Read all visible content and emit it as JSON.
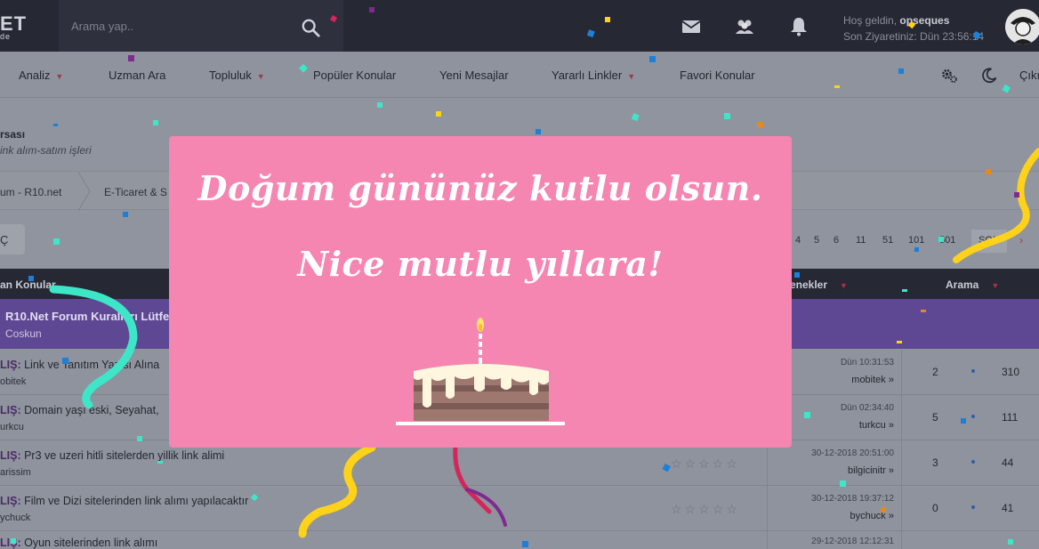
{
  "header": {
    "logo_text": "ET",
    "logo_sub": "de",
    "search_placeholder": "Arama yap..",
    "welcome_prefix": "Hoş geldin,",
    "username": "opseques",
    "last_visit": "Son Ziyaretiniz: Dün 23:56:14"
  },
  "nav": {
    "items": [
      "Analiz",
      "Uzman Ara",
      "Topluluk",
      "Popüler Konular",
      "Yeni Mesajlar",
      "Yararlı Linkler",
      "Favori Konular"
    ],
    "logout": "Çıkış"
  },
  "forum": {
    "title": "rsası",
    "description": "ink alım-satım işleri"
  },
  "breadcrumb": [
    "um - R10.net",
    "E-Ticaret & S"
  ],
  "pager": {
    "new_label": "Ç",
    "pages": [
      "4",
      "5",
      "6",
      "11",
      "51",
      "101",
      "501"
    ],
    "last": "SON",
    "next": "›"
  },
  "table_header": {
    "topics": "an Konular",
    "options": "enekler",
    "search": "Arama"
  },
  "sticky": {
    "title": "R10.Net Forum Kuralları Lütfe",
    "author": "Coskun"
  },
  "rows": [
    {
      "prefix": "LIŞ:",
      "title": "Link ve Tanıtım Yazısı Alına",
      "author": "obitek",
      "stars": "",
      "date": "Dün 10:31:53",
      "user": "mobitek",
      "replies": "2",
      "views": "310"
    },
    {
      "prefix": "LIŞ:",
      "title": "Domain yaşı eski, Seyahat,",
      "author": "urkcu",
      "stars": "",
      "date": "Dün 02:34:40",
      "user": "turkcu",
      "replies": "5",
      "views": "111"
    },
    {
      "prefix": "LIŞ:",
      "title": "Pr3 ve uzeri hitli sitelerden yillik link alimi",
      "author": "arissim",
      "stars": "☆☆☆☆☆",
      "date": "30-12-2018 20:51:00",
      "user": "bilgicinitr",
      "replies": "3",
      "views": "44"
    },
    {
      "prefix": "LIŞ:",
      "title": "Film ve Dizi sitelerinden link alımı yapılacaktır",
      "author": "ychuck",
      "stars": "☆☆☆☆☆",
      "date": "30-12-2018 19:37:12",
      "user": "bychuck",
      "replies": "0",
      "views": "41"
    },
    {
      "prefix": "LIŞ:",
      "title": "Oyun sitelerinden link alımı",
      "author": "",
      "stars": "",
      "date": "29-12-2018 12:12:31",
      "user": "",
      "replies": "",
      "views": ""
    }
  ],
  "modal": {
    "line1": "Doğum gününüz kutlu olsun.",
    "line2": "Nice mutlu yıllara!"
  },
  "colors": {
    "header_bg": "#262834",
    "sticky_bg": "#5e4894",
    "modal_bg": "#f585b1",
    "accent": "#b03046"
  }
}
